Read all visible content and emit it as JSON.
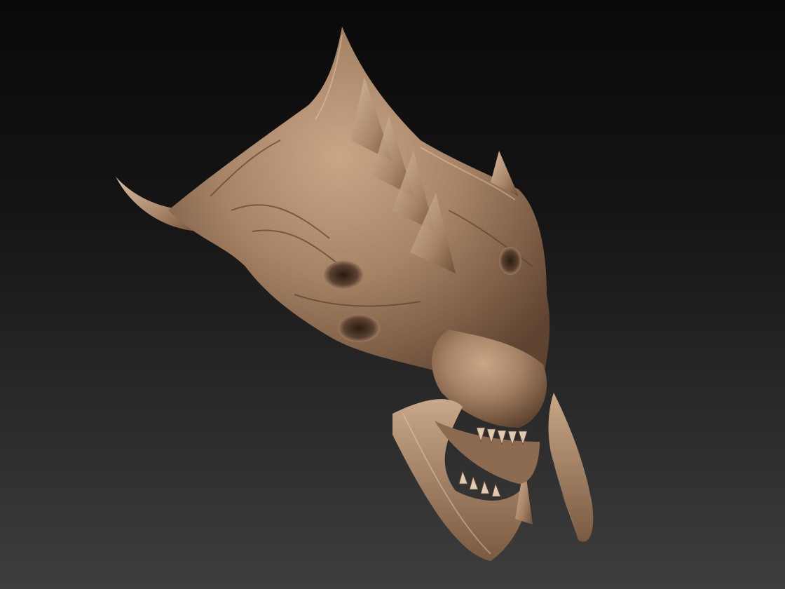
{
  "scene": {
    "subject": "sculpted-creature-head",
    "material_color": "#a88466",
    "shadow_color": "#5e4330",
    "highlight_color": "#d8bca0",
    "background_top": "#0a0a0a",
    "background_bottom": "#3e3e3e"
  }
}
